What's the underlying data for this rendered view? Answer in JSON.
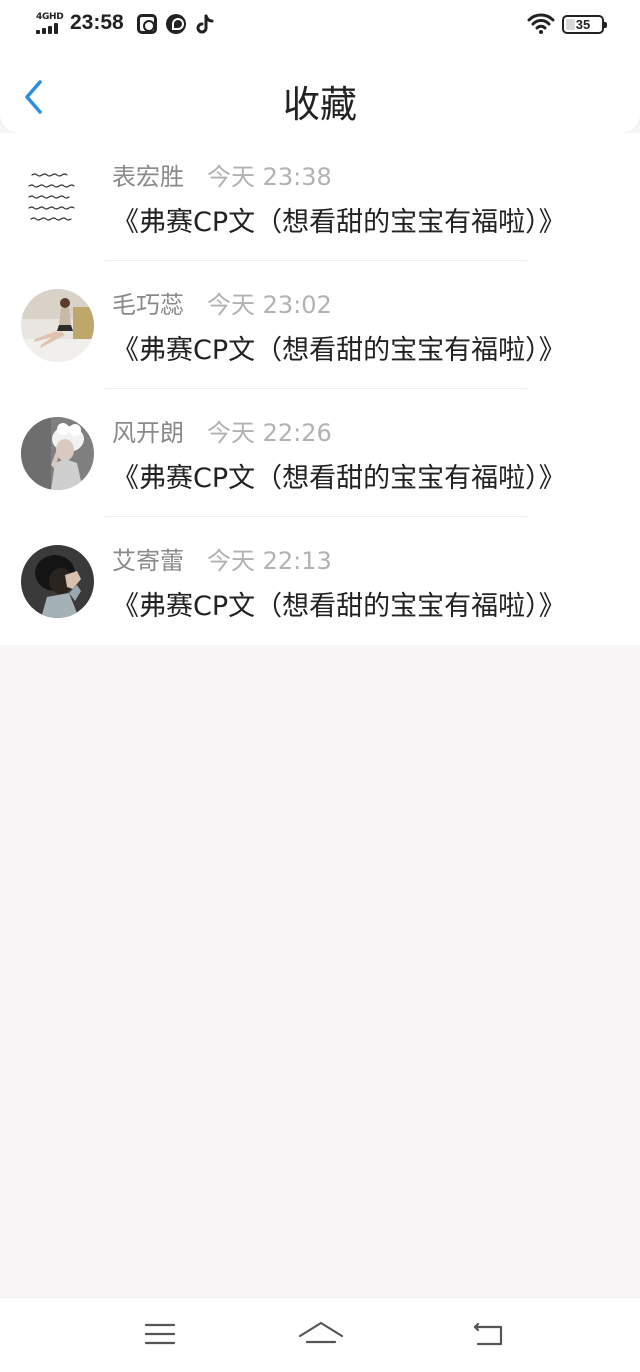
{
  "status_bar": {
    "network": "4GHD",
    "time": "23:58",
    "battery": "35",
    "battery_level": 0.35,
    "icons": [
      "signal-icon",
      "app-notification-icon",
      "app-browser-icon",
      "tiktok-icon",
      "wifi-icon",
      "battery-icon"
    ]
  },
  "header": {
    "title": "收藏",
    "back_icon": "chevron-left-icon",
    "accent_color": "#2a8ee6"
  },
  "favorites": [
    {
      "name": "表宏胜",
      "time": "今天 23:38",
      "message": "《弗赛CP文（想看甜的宝宝有福啦）》",
      "avatar": "handwritten-note-image"
    },
    {
      "name": "毛巧蕊",
      "time": "今天 23:02",
      "message": "《弗赛CP文（想看甜的宝宝有福啦）》",
      "avatar": "woman-sitting-photo"
    },
    {
      "name": "风开朗",
      "time": "今天 22:26",
      "message": "《弗赛CP文（想看甜的宝宝有福啦）》",
      "avatar": "white-hair-portrait-photo"
    },
    {
      "name": "艾寄蕾",
      "time": "今天 22:13",
      "message": "《弗赛CP文（想看甜的宝宝有福啦）》",
      "avatar": "hand-covering-face-photo"
    }
  ],
  "navigation": {
    "keys": [
      "menu-icon",
      "home-icon",
      "back-icon"
    ]
  }
}
